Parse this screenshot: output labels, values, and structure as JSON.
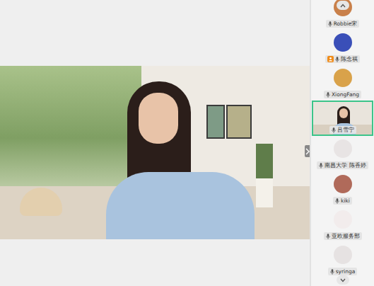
{
  "participants": [
    {
      "name": "Robbie宋",
      "selected": false,
      "host": false,
      "video": false,
      "color": "#c9804a"
    },
    {
      "name": "陈念祺",
      "selected": false,
      "host": true,
      "video": false,
      "color": "#3a4fb8"
    },
    {
      "name": "XiongFang",
      "selected": false,
      "host": false,
      "video": false,
      "color": "#d9a24a"
    },
    {
      "name": "吕雪宁",
      "selected": true,
      "host": false,
      "video": true,
      "color": "#cdd6c4"
    },
    {
      "name": "南昌大学 陈香婷",
      "selected": false,
      "host": false,
      "video": false,
      "color": "#e8e4e4"
    },
    {
      "name": "kiki",
      "selected": false,
      "host": false,
      "video": false,
      "color": "#b06a5a"
    },
    {
      "name": "亚欧服务部",
      "selected": false,
      "host": false,
      "video": false,
      "color": "#f2ecec"
    },
    {
      "name": "syringa",
      "selected": false,
      "host": false,
      "video": false,
      "color": "#e6e2e2"
    }
  ]
}
